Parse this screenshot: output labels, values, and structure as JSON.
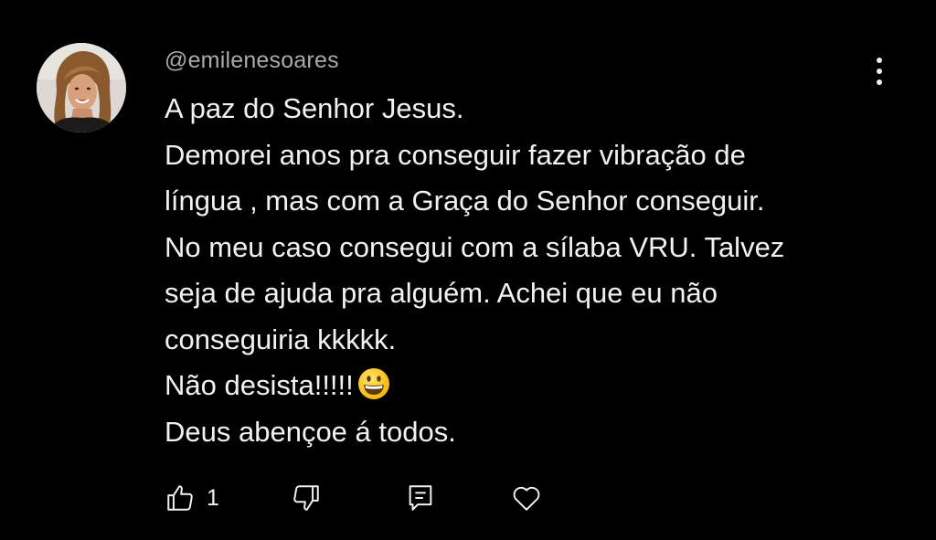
{
  "comment": {
    "author_handle": "@emilenesoares",
    "text_lines": [
      "A paz do Senhor Jesus.",
      "Demorei anos pra conseguir fazer vibração de",
      "língua , mas com a Graça do Senhor conseguir.",
      "No meu caso consegui com a sílaba VRU. Talvez",
      "seja de ajuda pra alguém. Achei que eu não",
      "conseguiria kkkkk.",
      "Não desista!!!!!",
      "Deus abençoe á todos."
    ],
    "emoji_after_line_7": "grinning-face-emoji",
    "like_count": "1"
  },
  "icons": {
    "like": "thumbs-up-icon",
    "dislike": "thumbs-down-icon",
    "reply": "reply-comment-icon",
    "heart": "heart-icon",
    "menu": "more-vertical-icon"
  },
  "colors": {
    "background": "#000000",
    "text": "#f1f1f1",
    "secondary_text": "#aaaaaa"
  }
}
